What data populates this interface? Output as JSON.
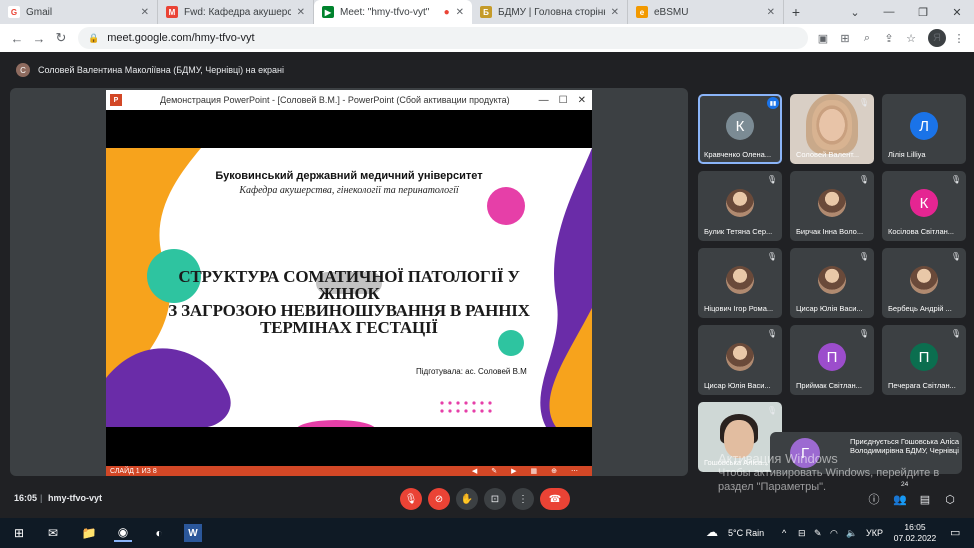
{
  "browser": {
    "tabs": [
      {
        "title": "Gmail",
        "active": false
      },
      {
        "title": "Fwd: Кафедра акушерства т",
        "active": false
      },
      {
        "title": "Meet: \"hmy-tfvo-vyt\"",
        "active": true
      },
      {
        "title": "БДМУ | Головна сторінка",
        "active": false
      },
      {
        "title": "eBSMU",
        "active": false
      }
    ],
    "new_tab": "+",
    "url": "meet.google.com/hmy-tfvo-vyt",
    "profile_initial": "Я"
  },
  "presenting_banner": {
    "initial": "С",
    "text": "Соловей Валентина Маколіївна (БДМУ, Чернівці) на екрані"
  },
  "ppt": {
    "window_title": "Демонстрация PowerPoint - [Соловей В.М.] - PowerPoint (Сбой активации продукта)",
    "slide": {
      "university": "Буковинський державний медичний університет",
      "department": "Кафедра акушерства, гінекології та перинатології",
      "title_lines": [
        "СТРУКТУРА СОМАТИЧНОЇ ПАТОЛОГІЇ У ЖІНОК",
        "З ЗАГРОЗОЮ НЕВИНОШУВАННЯ В РАННІХ",
        "ТЕРМІНАХ ГЕСТАЦІЇ"
      ],
      "author": "Підготувала: ас. Соловей В.М"
    },
    "status": "СЛАЙД 1 ИЗ 8"
  },
  "participants": [
    {
      "name": "Кравченко Олена...",
      "initial": "К",
      "color": "#7b8b94",
      "mic": "active"
    },
    {
      "name": "Соловей Валент...",
      "initial": "",
      "color": "",
      "mic": "off",
      "video": true
    },
    {
      "name": "Лілія Lilliya",
      "initial": "Л",
      "color": "#1a73e8",
      "mic": "none"
    },
    {
      "name": "Булик Тетяна Сер...",
      "initial": "",
      "color": "photo",
      "mic": "off"
    },
    {
      "name": "Бирчак Інна Воло...",
      "initial": "",
      "color": "photo",
      "mic": "off"
    },
    {
      "name": "Косілова Світлан...",
      "initial": "К",
      "color": "#e52592",
      "mic": "off"
    },
    {
      "name": "Ніцович Ігор Рома...",
      "initial": "",
      "color": "photo",
      "mic": "off"
    },
    {
      "name": "Цисар Юлія Васи...",
      "initial": "",
      "color": "photo",
      "mic": "off"
    },
    {
      "name": "Бербець Андрій ...",
      "initial": "",
      "color": "photo",
      "mic": "off"
    },
    {
      "name": "Цисар Юлія Васи...",
      "initial": "",
      "color": "photo",
      "mic": "off"
    },
    {
      "name": "Приймак Світлан...",
      "initial": "П",
      "color": "#9c4dcc",
      "mic": "off"
    },
    {
      "name": "Печерага Світлан...",
      "initial": "П",
      "color": "#0b6e4f",
      "mic": "off"
    },
    {
      "name": "Гошовська Аліса...",
      "initial": "",
      "color": "",
      "mic": "off",
      "video": true
    }
  ],
  "notification": {
    "initial": "Г",
    "text": "Приєднується Гошовська Аліса Володимирівна БДМУ, Чернівці"
  },
  "watermark": {
    "line1": "Активация Windows",
    "line2": "Чтобы активировать Windows, перейдите в",
    "line3": "раздел \"Параметры\"."
  },
  "meet_controls": {
    "time": "16:05",
    "separator": "|",
    "meeting_code": "hmy-tfvo-vyt",
    "participant_count": "24"
  },
  "taskbar": {
    "weather": "5°C Rain",
    "language": "УКР",
    "time": "16:05",
    "date": "07.02.2022"
  },
  "colors": {
    "meet_bg": "#202124",
    "tile_bg": "#3c4043",
    "end_call": "#ea4335",
    "ppt_accent": "#d24726",
    "slide_orange": "#f7a31c",
    "slide_purple": "#6a2ca8",
    "slide_pink": "#e63fa8",
    "slide_teal": "#2ec4a0"
  }
}
